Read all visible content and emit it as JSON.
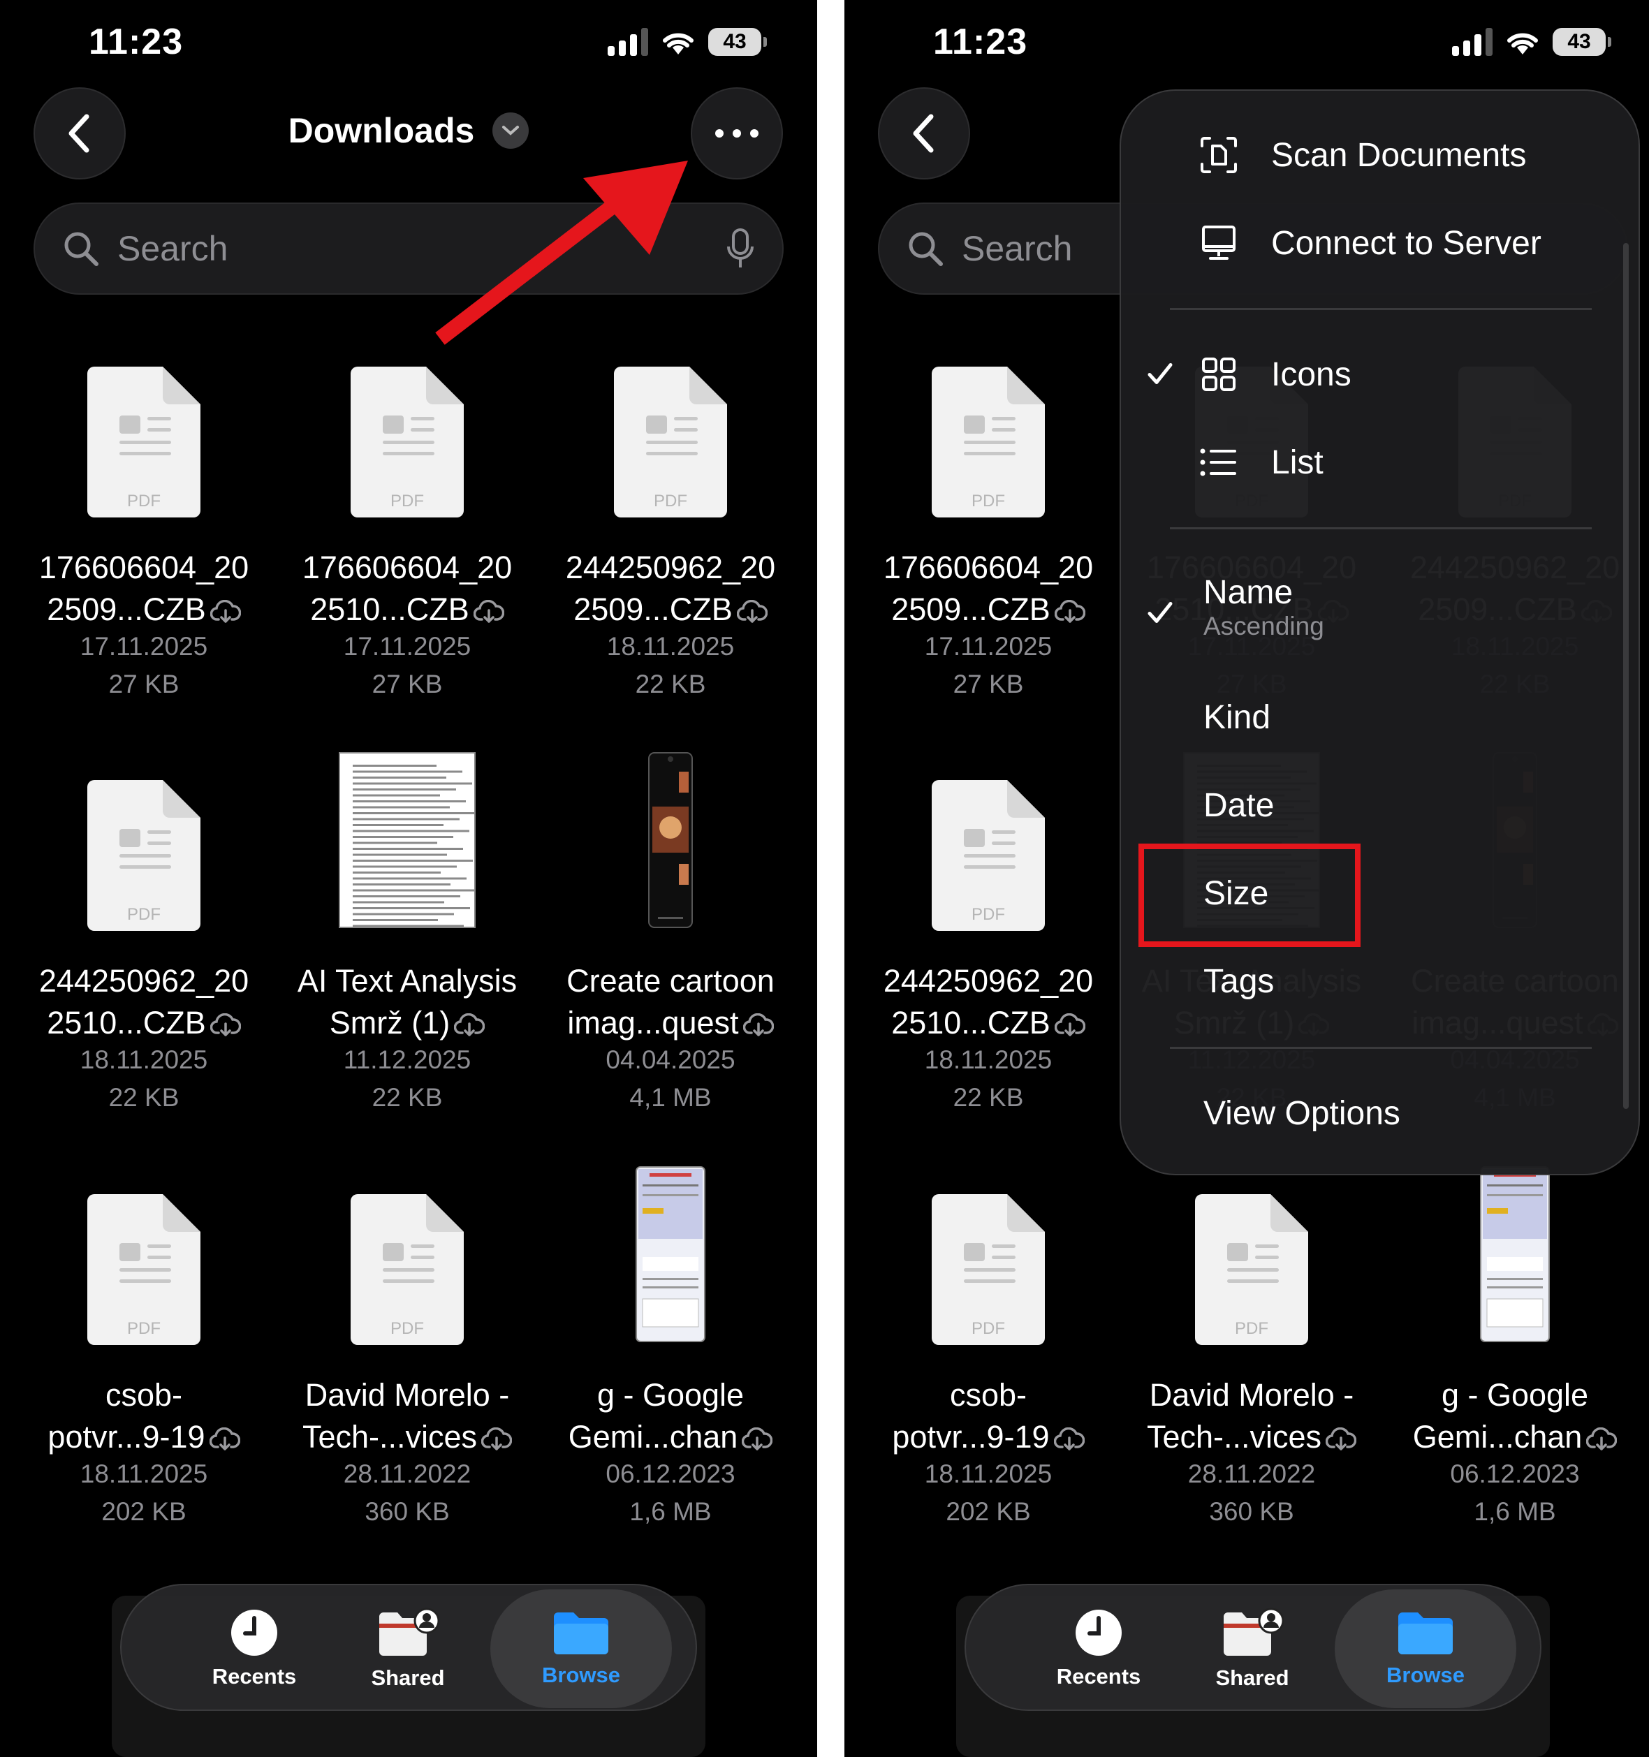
{
  "status": {
    "time": "11:23",
    "battery": "43"
  },
  "header": {
    "title": "Downloads"
  },
  "search": {
    "placeholder": "Search"
  },
  "files": [
    {
      "name1": "176606604_20",
      "name2": "2509...CZB",
      "date": "17.11.2025",
      "size": "27 KB",
      "kind": "pdf",
      "badge": "PDF"
    },
    {
      "name1": "176606604_20",
      "name2": "2510...CZB",
      "date": "17.11.2025",
      "size": "27 KB",
      "kind": "pdf",
      "badge": "PDF"
    },
    {
      "name1": "244250962_20",
      "name2": "2509...CZB",
      "date": "18.11.2025",
      "size": "22 KB",
      "kind": "pdf",
      "badge": "PDF"
    },
    {
      "name1": "244250962_20",
      "name2": "2510...CZB",
      "date": "18.11.2025",
      "size": "22 KB",
      "kind": "pdf",
      "badge": "PDF"
    },
    {
      "name1": "AI Text Analysis",
      "name2": "Smrž (1)",
      "date": "11.12.2025",
      "size": "22 KB",
      "kind": "doc"
    },
    {
      "name1": "Create cartoon",
      "name2": "imag...quest",
      "date": "04.04.2025",
      "size": "4,1 MB",
      "kind": "phone"
    },
    {
      "name1": "csob-",
      "name2": "potvr...9-19",
      "date": "18.11.2025",
      "size": "202 KB",
      "kind": "pdf",
      "badge": "PDF"
    },
    {
      "name1": "David Morelo -",
      "name2": "Tech-...vices",
      "date": "28.11.2022",
      "size": "360 KB",
      "kind": "pdf",
      "badge": "PDF"
    },
    {
      "name1": "g - Google",
      "name2": "Gemi...chan",
      "date": "06.12.2023",
      "size": "1,6 MB",
      "kind": "web"
    }
  ],
  "tabs": [
    {
      "label": "Recents",
      "icon": "clock-icon"
    },
    {
      "label": "Shared",
      "icon": "shared-folder-icon"
    },
    {
      "label": "Browse",
      "icon": "folder-icon"
    }
  ],
  "menu": {
    "scan": "Scan Documents",
    "connect": "Connect to Server",
    "icons": "Icons",
    "list": "List",
    "name": "Name",
    "name_sub": "Ascending",
    "kind": "Kind",
    "date": "Date",
    "size": "Size",
    "tags": "Tags",
    "view_options": "View Options"
  },
  "colors": {
    "accent": "#2f9bff",
    "annotation": "#e5161c",
    "background": "#000000"
  }
}
